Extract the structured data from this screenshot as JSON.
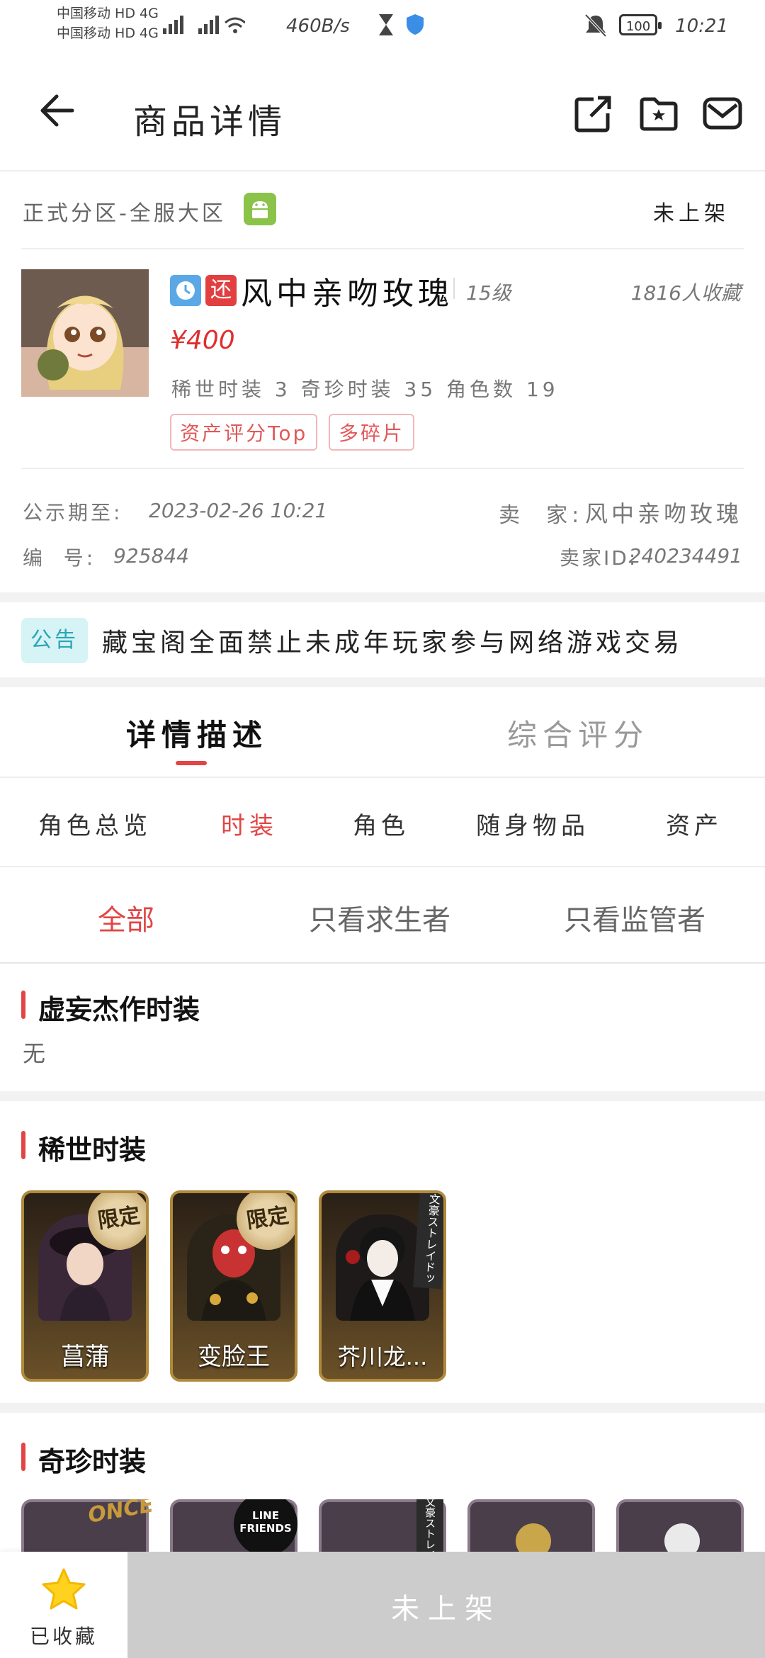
{
  "status_bar": {
    "carrier1": "中国移动 HD 4G",
    "carrier2": "中国移动 HD 4G",
    "speed": "460B/s",
    "battery": "100",
    "time": "10:21"
  },
  "header": {
    "title": "商品详情"
  },
  "server": {
    "label": "正式分区-全服大区",
    "status": "未上架"
  },
  "item": {
    "name": "风中亲吻玫瑰",
    "badge_return": "还",
    "level": "15级",
    "favorites": "1816人收藏",
    "price": "¥400",
    "stats": "稀世时装 3 奇珍时装 35 角色数 19",
    "chips": [
      "资产评分Top",
      "多碎片"
    ]
  },
  "meta": {
    "announce_label": "公示期至:",
    "announce_value": "2023-02-26 10:21",
    "seller_label": "卖  家:",
    "seller_value": "风中亲吻玫瑰",
    "id_label": "编  号:",
    "id_value": "925844",
    "seller_id_label": "卖家ID:",
    "seller_id_value": "240234491"
  },
  "notice": {
    "tag": "公告",
    "text": "藏宝阁全面禁止未成年玩家参与网络游戏交易"
  },
  "main_tabs": [
    "详情描述",
    "综合评分"
  ],
  "sub_tabs": [
    "角色总览",
    "时装",
    "角色",
    "随身物品",
    "资产"
  ],
  "filters": [
    "全部",
    "只看求生者",
    "只看监管者"
  ],
  "sections": {
    "masterpiece": {
      "title": "虚妄杰作时装",
      "empty_text": "无"
    },
    "rare": {
      "title": "稀世时装",
      "cards": [
        {
          "name": "菖蒲",
          "tag": "限定"
        },
        {
          "name": "变脸王",
          "tag": "限定"
        },
        {
          "name": "芥川龙...",
          "tag": "文豪ストレイドッグス"
        }
      ]
    },
    "treasure": {
      "title": "奇珍时装",
      "logo1": "ONCE",
      "logo2": "LINE FRIENDS",
      "tag3": "文豪ストレイ"
    }
  },
  "bottom": {
    "favorite_label": "已收藏",
    "action_label": "未上架"
  },
  "colors": {
    "accent": "#e24545",
    "price": "#e02e2e",
    "notice_tag_bg": "#d6f3f5",
    "notice_tag_fg": "#2aa6b8",
    "bottom_action_bg": "#cccccc"
  }
}
